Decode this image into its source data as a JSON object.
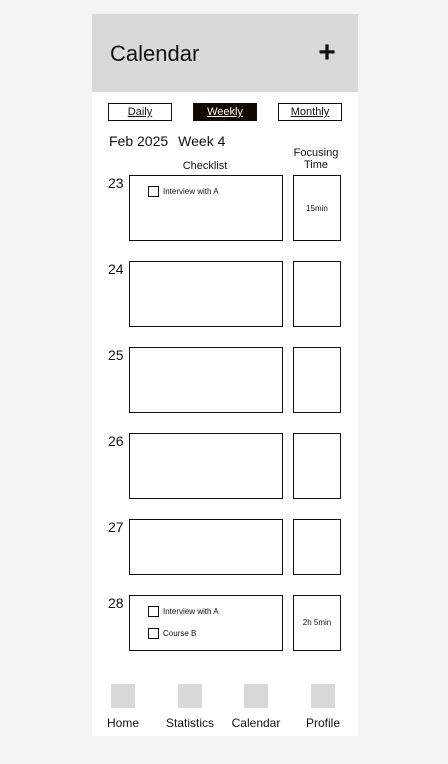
{
  "header": {
    "title": "Calendar",
    "add_symbol": "+"
  },
  "tabs": [
    {
      "label": "Daily",
      "active": false
    },
    {
      "label": "Weekly",
      "active": true
    },
    {
      "label": "Monthly",
      "active": false
    }
  ],
  "period": {
    "month": "Feb 2025",
    "week": "Week 4"
  },
  "columns": {
    "checklist": "Checklist",
    "focus_line1": "Focusing",
    "focus_line2": "Time"
  },
  "days": [
    {
      "day": "23",
      "tasks": [
        "Interview with A"
      ],
      "focus_time": "15min"
    },
    {
      "day": "24",
      "tasks": [],
      "focus_time": ""
    },
    {
      "day": "25",
      "tasks": [],
      "focus_time": ""
    },
    {
      "day": "26",
      "tasks": [],
      "focus_time": ""
    },
    {
      "day": "27",
      "tasks": [],
      "focus_time": ""
    },
    {
      "day": "28",
      "tasks": [
        "Interview with A",
        "Course B"
      ],
      "focus_time": "2h 5min"
    }
  ],
  "nav": [
    {
      "label": "Home",
      "icon": "home-icon"
    },
    {
      "label": "Statistics",
      "icon": "statistics-icon"
    },
    {
      "label": "Calendar",
      "icon": "calendar-icon"
    },
    {
      "label": "Profile",
      "icon": "profile-icon"
    }
  ]
}
